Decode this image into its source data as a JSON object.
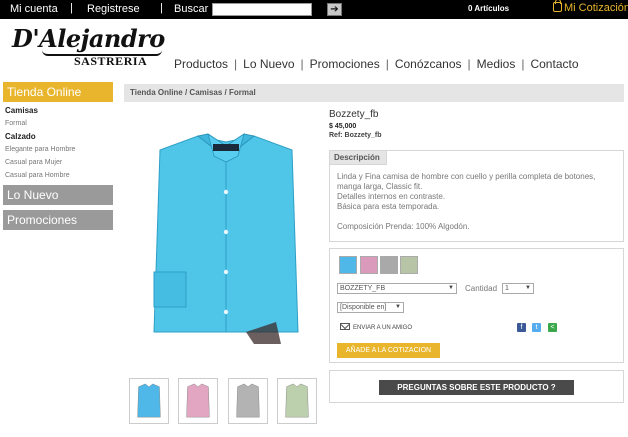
{
  "topbar": {
    "account": "Mi cuenta",
    "sep1": "|",
    "register": "Registrese",
    "sep2": "|",
    "search_label": "Buscar",
    "search_value": "",
    "search_button": "➔",
    "cart_count": "0 Artículos",
    "quote": "Mi Cotización"
  },
  "logo": {
    "script": "D'Alejandro",
    "sub": "SASTRERIA"
  },
  "nav": {
    "items": [
      "Productos",
      "Lo Nuevo",
      "Promociones",
      "Conózcanos",
      "Medios",
      "Contacto"
    ],
    "separator": "|"
  },
  "sidebar": {
    "tienda": "Tienda Online",
    "categories": [
      {
        "label": "Camisas",
        "kind": "cat"
      },
      {
        "label": "Formal",
        "kind": "sub"
      },
      {
        "label": "Calzado",
        "kind": "cat"
      },
      {
        "label": "Elegante para Hombre",
        "kind": "sub"
      },
      {
        "label": "Casual para Mujer",
        "kind": "sub"
      },
      {
        "label": "Casual para Hombre",
        "kind": "sub"
      }
    ],
    "lo_nuevo": "Lo Nuevo",
    "promociones": "Promociones"
  },
  "breadcrumb": "Tienda Online / Camisas / Formal",
  "product": {
    "name": "Bozzety_fb",
    "price": "$ 45,000",
    "ref": "Ref: Bozzety_fb",
    "desc_tab": "Descripción",
    "desc_lines": [
      "Linda y Fina camisa de hombre con cuello y perilla completa de botones,",
      "manga larga, Classic fit.",
      "Detalles internos en contraste.",
      "Básica para esta temporada."
    ],
    "composition": "Composición Prenda: 100% Algodón.",
    "swatches": [
      "#4fb8e8",
      "#d99abb",
      "#a9a9a9",
      "#b8c4a6"
    ],
    "thumb_colors": [
      "#4fb8e8",
      "#e2a6c2",
      "#b3b3b3",
      "#bcd0ad"
    ],
    "variant_select": "BOZZETY_FB",
    "qty_label": "Cantidad",
    "qty_value": "1",
    "availability": "[Disponible en]",
    "send_friend": "ENVIAR A UN AMIGO",
    "add_button": "AÑADE A LA COTIZACION",
    "questions_button": "PREGUNTAS SOBRE ESTE PRODUCTO ?",
    "shirt_color": "#4fc6e8",
    "accent": "#e8b52c"
  }
}
